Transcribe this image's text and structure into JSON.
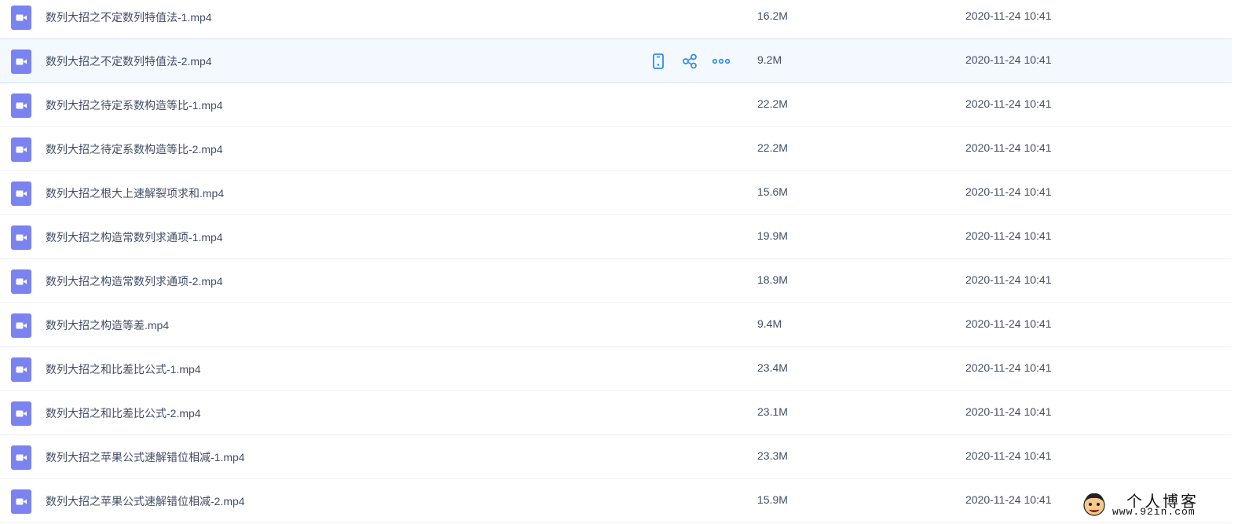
{
  "file_icon": "video-file-icon",
  "colors": {
    "icon": "#7b83f0",
    "text": "#424e67",
    "action": "#2d8cf0",
    "hover_bg": "#f3f9ff"
  },
  "row_actions": {
    "icons": [
      "phone-icon",
      "share-icon",
      "more-icon"
    ]
  },
  "files": [
    {
      "name": "数列大招之不定数列特值法-1.mp4",
      "size": "16.2M",
      "date": "2020-11-24 10:41"
    },
    {
      "name": "数列大招之不定数列特值法-2.mp4",
      "size": "9.2M",
      "date": "2020-11-24 10:41"
    },
    {
      "name": "数列大招之待定系数构造等比-1.mp4",
      "size": "22.2M",
      "date": "2020-11-24 10:41"
    },
    {
      "name": "数列大招之待定系数构造等比-2.mp4",
      "size": "22.2M",
      "date": "2020-11-24 10:41"
    },
    {
      "name": "数列大招之根大上速解裂项求和.mp4",
      "size": "15.6M",
      "date": "2020-11-24 10:41"
    },
    {
      "name": "数列大招之构造常数列求通项-1.mp4",
      "size": "19.9M",
      "date": "2020-11-24 10:41"
    },
    {
      "name": "数列大招之构造常数列求通项-2.mp4",
      "size": "18.9M",
      "date": "2020-11-24 10:41"
    },
    {
      "name": "数列大招之构造等差.mp4",
      "size": "9.4M",
      "date": "2020-11-24 10:41"
    },
    {
      "name": "数列大招之和比差比公式-1.mp4",
      "size": "23.4M",
      "date": "2020-11-24 10:41"
    },
    {
      "name": "数列大招之和比差比公式-2.mp4",
      "size": "23.1M",
      "date": "2020-11-24 10:41"
    },
    {
      "name": "数列大招之苹果公式速解错位相减-1.mp4",
      "size": "23.3M",
      "date": "2020-11-24 10:41"
    },
    {
      "name": "数列大招之苹果公式速解错位相减-2.mp4",
      "size": "15.9M",
      "date": "2020-11-24 10:41"
    }
  ],
  "watermark": {
    "title": "个人博客",
    "url": "www.92in.com"
  }
}
